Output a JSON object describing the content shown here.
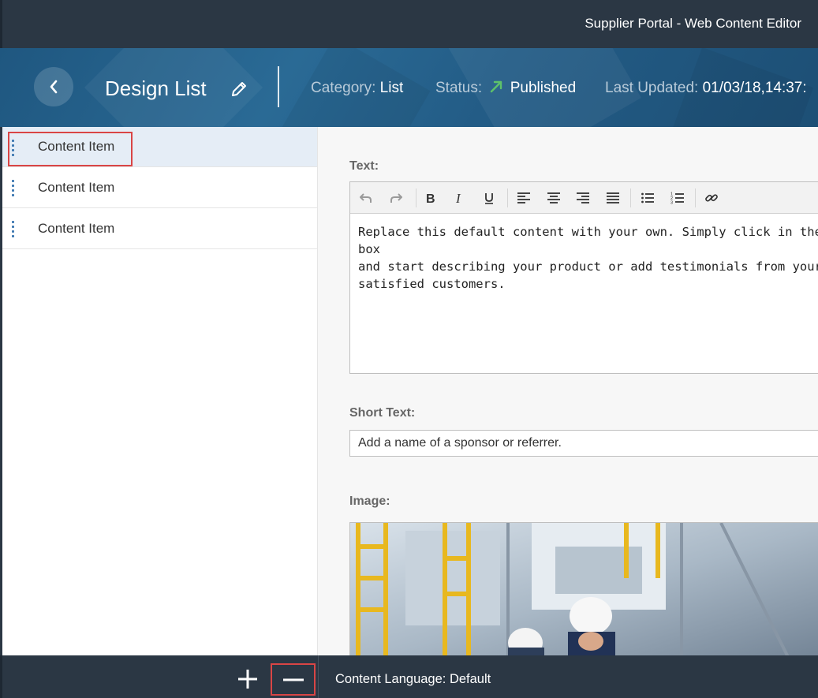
{
  "shell": {
    "title": "Supplier Portal - Web Content Editor"
  },
  "header": {
    "title": "Design List",
    "category_label": "Category:",
    "category_value": "List",
    "status_label": "Status:",
    "status_value": "Published",
    "updated_label": "Last Updated:",
    "updated_value": "01/03/18,14:37:"
  },
  "master": {
    "items": [
      {
        "label": "Content Item",
        "selected": true
      },
      {
        "label": "Content Item",
        "selected": false
      },
      {
        "label": "Content Item",
        "selected": false
      }
    ]
  },
  "detail": {
    "text_label": "Text:",
    "text_body": "Replace this default content with your own. Simply click in the box\nand start describing your product or add testimonials from your\nsatisfied customers.",
    "short_text_label": "Short Text:",
    "short_text_value": "Add a name of a sponsor or referrer.",
    "image_label": "Image:",
    "toolbar_icons": [
      "undo-icon",
      "redo-icon",
      "bold-icon",
      "italic-icon",
      "underline-icon",
      "align-left-icon",
      "align-center-icon",
      "align-right-icon",
      "align-justify-icon",
      "bullet-list-icon",
      "numbered-list-icon",
      "link-icon"
    ]
  },
  "footer": {
    "content_language": "Content Language: Default"
  },
  "colors": {
    "shell_bg": "#2b3744",
    "header_bg": "#235c86",
    "status_green": "#5ec26a",
    "highlight_red": "#d94545",
    "selected_bg": "#e5edf6"
  }
}
